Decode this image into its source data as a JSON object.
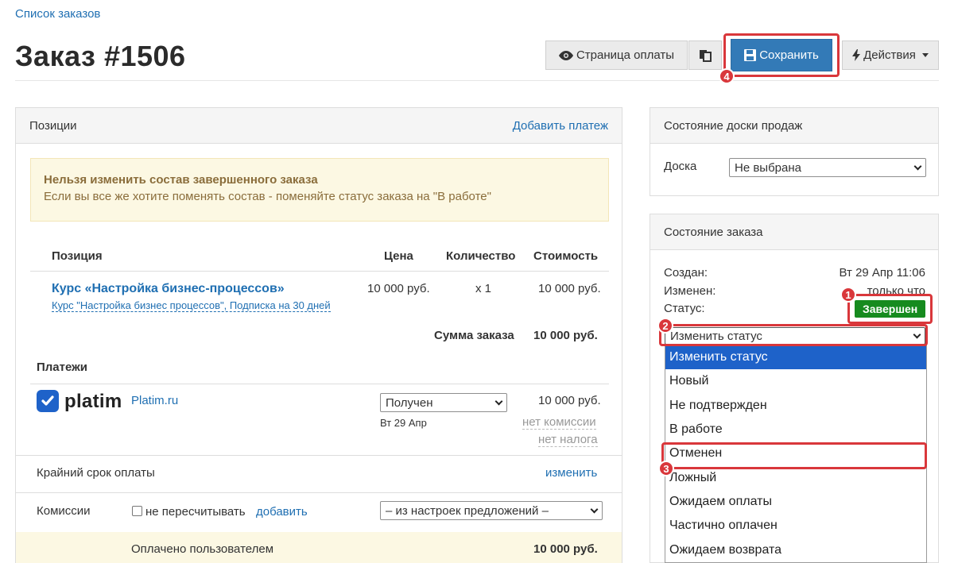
{
  "breadcrumb": "Список заказов",
  "title": "Заказ #1506",
  "toolbar": {
    "payment_page": "Страница оплаты",
    "save": "Сохранить",
    "actions": "Действия"
  },
  "markers": [
    "1",
    "2",
    "3",
    "4"
  ],
  "positions_panel": {
    "title": "Позиции",
    "add_payment": "Добавить платеж",
    "alert_title": "Нельзя изменить состав завершенного заказа",
    "alert_text": "Если вы все же хотите поменять состав - поменяйте статус заказа на \"В работе\"",
    "columns": [
      "Позиция",
      "Цена",
      "Количество",
      "Стоимость"
    ],
    "item": {
      "name": "Курс «Настройка бизнес-процессов»",
      "sub": "Курс \"Настройка бизнес процессов\", Подписка на 30 дней",
      "price": "10 000 руб.",
      "qty": "x 1",
      "cost": "10 000 руб."
    },
    "sum_label": "Сумма заказа",
    "sum_value": "10 000 руб.",
    "payments_label": "Платежи",
    "payment": {
      "brand": "platim",
      "link": "Platim.ru",
      "status": "Получен",
      "date": "Вт 29 Апр",
      "amount": "10 000 руб.",
      "commission": "нет комиссии",
      "tax": "нет налога"
    },
    "deadline_label": "Крайний срок оплаты",
    "deadline_link": "изменить",
    "commissions_label": "Комиссии",
    "no_recalc": "не пересчитывать",
    "add_link": "добавить",
    "commission_select": "– из настроек предложений –",
    "paid_label": "Оплачено пользователем",
    "paid_value": "10 000 руб."
  },
  "board_panel": {
    "title": "Состояние доски продаж",
    "board_label": "Доска",
    "board_value": "Не выбрана"
  },
  "order_state": {
    "title": "Состояние заказа",
    "created_label": "Создан:",
    "created_value": "Вт 29 Апр 11:06",
    "changed_label": "Изменен:",
    "changed_value": "только что",
    "status_label": "Статус:",
    "status_badge": "Завершен",
    "change_status": "Изменить статус",
    "options": [
      "Изменить статус",
      "Новый",
      "Не подтвержден",
      "В работе",
      "Отменен",
      "Ложный",
      "Ожидаем оплаты",
      "Частично оплачен",
      "Ожидаем возврата"
    ]
  },
  "colors": {
    "primary": "#337ab7",
    "highlight": "#d9373b",
    "success": "#168b1f",
    "link": "#1f6fb2"
  }
}
